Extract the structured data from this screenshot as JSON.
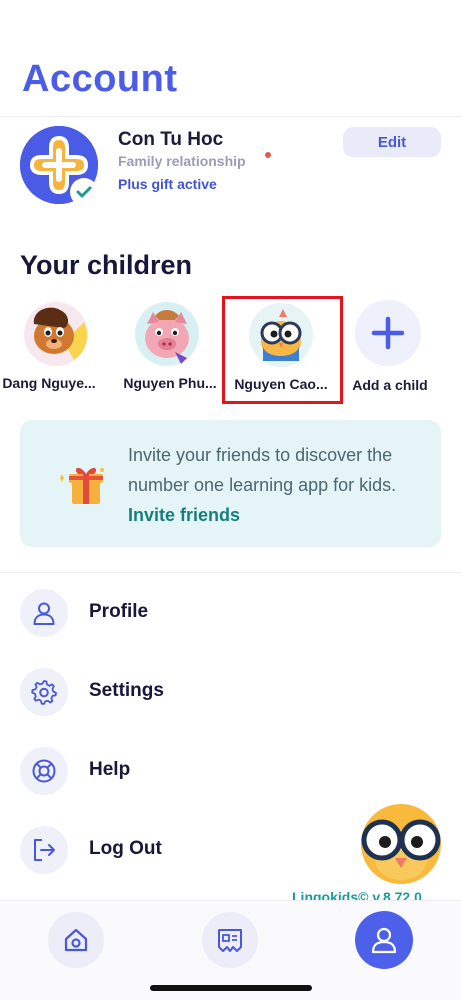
{
  "header": {
    "title": "Account"
  },
  "account": {
    "name": "Con Tu Hoc",
    "relationship": "Family relationship",
    "plan": "Plus gift active",
    "edit_label": "Edit"
  },
  "children_section": {
    "title": "Your children",
    "children": [
      {
        "name": "Dang Nguye...",
        "selected": false
      },
      {
        "name": "Nguyen Phu...",
        "selected": false
      },
      {
        "name": "Nguyen Cao...",
        "selected": true
      }
    ],
    "add_label": "Add a child"
  },
  "invite": {
    "text": "Invite your friends to discover the number one learning app for kids. ",
    "link": "Invite friends"
  },
  "menu": [
    {
      "label": "Profile",
      "icon": "person-icon"
    },
    {
      "label": "Settings",
      "icon": "gear-icon"
    },
    {
      "label": "Help",
      "icon": "lifebuoy-icon"
    },
    {
      "label": "Log Out",
      "icon": "logout-icon"
    }
  ],
  "version": "Lingokids© v.8.72.0",
  "tabbar": [
    {
      "name": "home",
      "icon": "home-icon",
      "active": false
    },
    {
      "name": "parents",
      "icon": "news-card-icon",
      "active": false
    },
    {
      "name": "account",
      "icon": "person-icon",
      "active": true
    }
  ],
  "colors": {
    "accent": "#4b5ce8",
    "selection_border": "#e3141b",
    "invite_bg": "#e5f5f7",
    "invite_link": "#167f7c"
  }
}
